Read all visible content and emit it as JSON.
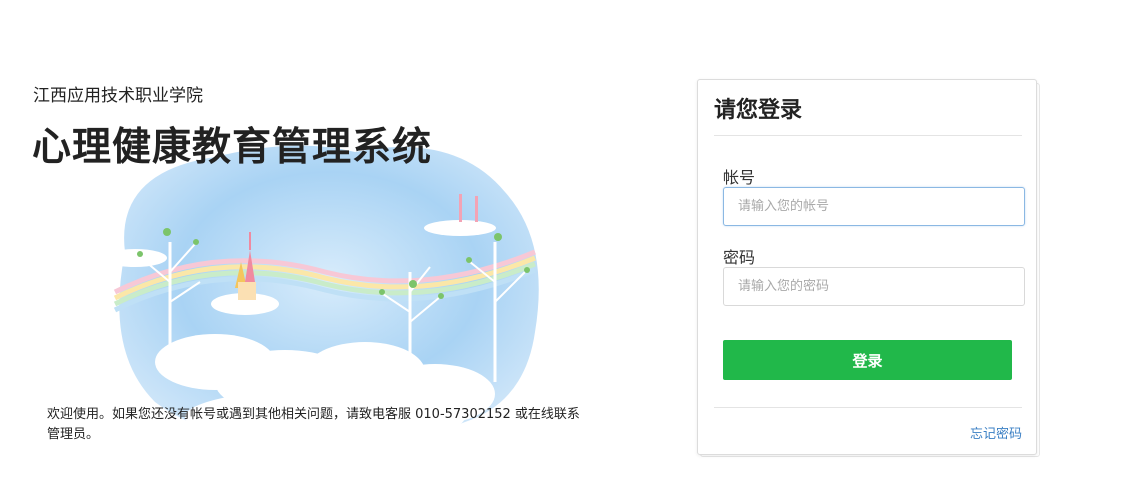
{
  "header": {
    "school_name": "江西应用技术职业学院",
    "system_title": "心理健康教育管理系统"
  },
  "welcome": {
    "message": "欢迎使用。如果您还没有帐号或遇到其他相关问题，请致电客服 010-57302152 或在线联系管理员。"
  },
  "login": {
    "title": "请您登录",
    "account_label": "帐号",
    "account_placeholder": "请输入您的帐号",
    "account_value": "",
    "password_label": "密码",
    "password_placeholder": "请输入您的密码",
    "password_value": "",
    "submit_label": "登录",
    "forgot_label": "忘记密码"
  },
  "colors": {
    "accent_green": "#21b84a",
    "link_blue": "#3a7fc4",
    "focus_border": "#8bb8e3"
  }
}
